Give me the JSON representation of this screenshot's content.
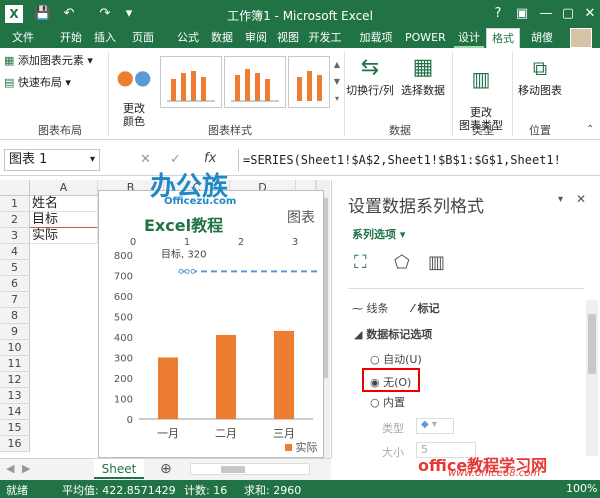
{
  "window": {
    "title": "工作簿1 - Microsoft Excel"
  },
  "quick_access": {
    "save": "💾",
    "undo": "↶",
    "redo": "↷"
  },
  "window_controls": {
    "help": "?",
    "ribbon_opts": "▣",
    "minimize": "—",
    "restore": "▢",
    "close": "✕"
  },
  "tabs": [
    "开始",
    "插入",
    "页面布",
    "公式",
    "数据",
    "审阅",
    "视图",
    "开发工",
    "加载项",
    "POWER",
    "设计",
    "格式"
  ],
  "file_tab": "文件",
  "user_name": "胡傻",
  "ribbon": {
    "add_element": "添加图表元素",
    "quick_layout": "快速布局",
    "change_colors": "更改\n颜色",
    "switch_row_col": "切换行/列",
    "select_data": "选择数据",
    "change_type": "更改\n图表类型",
    "move_chart": "移动图表",
    "groups": {
      "layouts": "图表布局",
      "styles": "图表样式",
      "data": "数据",
      "type": "类型",
      "location": "位置"
    }
  },
  "formula_bar": {
    "name_box": "图表 1",
    "fx": "fx",
    "formula": "=SERIES(Sheet1!$A$2,Sheet1!$B$1:$G$1,Sheet1!"
  },
  "columns": [
    "A",
    "B",
    "C",
    "D"
  ],
  "rows": [
    "1",
    "2",
    "3",
    "4",
    "5",
    "6",
    "7",
    "8",
    "9",
    "10",
    "11",
    "12",
    "13",
    "14",
    "15",
    "16"
  ],
  "cells": {
    "a1": "姓名",
    "a2": "目标",
    "a3": "实际"
  },
  "chart": {
    "title_partial": "图表",
    "top_axis": [
      "0",
      "1",
      "2",
      "3"
    ],
    "y_ticks": [
      "800",
      "700",
      "600",
      "500",
      "400",
      "300",
      "200",
      "100",
      "0"
    ],
    "data_label": "目标, 320",
    "legend_partial": "实际"
  },
  "chart_data": {
    "type": "bar",
    "categories": [
      "一月",
      "二月",
      "三月"
    ],
    "series": [
      {
        "name": "实际",
        "values": [
          300,
          410,
          430
        ]
      },
      {
        "name": "目标",
        "values": [
          720
        ]
      }
    ],
    "ylim": [
      0,
      800
    ],
    "colors": {
      "actual": "#ed7d31",
      "target": "#5b9bd5"
    }
  },
  "sheet_tab": "Sheet",
  "pane": {
    "title": "设置数据系列格式",
    "section": "系列选项",
    "tab_line": "线条",
    "tab_marker": "标记",
    "group": "数据标记选项",
    "opt_auto": "自动(U)",
    "opt_none": "无(O)",
    "opt_builtin": "内置",
    "type_label": "类型",
    "size_label": "大小",
    "size_value": "5"
  },
  "status": {
    "ready": "就绪",
    "avg": "平均值: 422.8571429",
    "count": "计数: 16",
    "sum": "求和: 2960",
    "zoom": "100%"
  },
  "watermark": {
    "logo": "办公族",
    "site1": "Officezu.com",
    "excel": "Excel教程",
    "bottom": "office教程学习网",
    "url": "www.office68.com"
  }
}
